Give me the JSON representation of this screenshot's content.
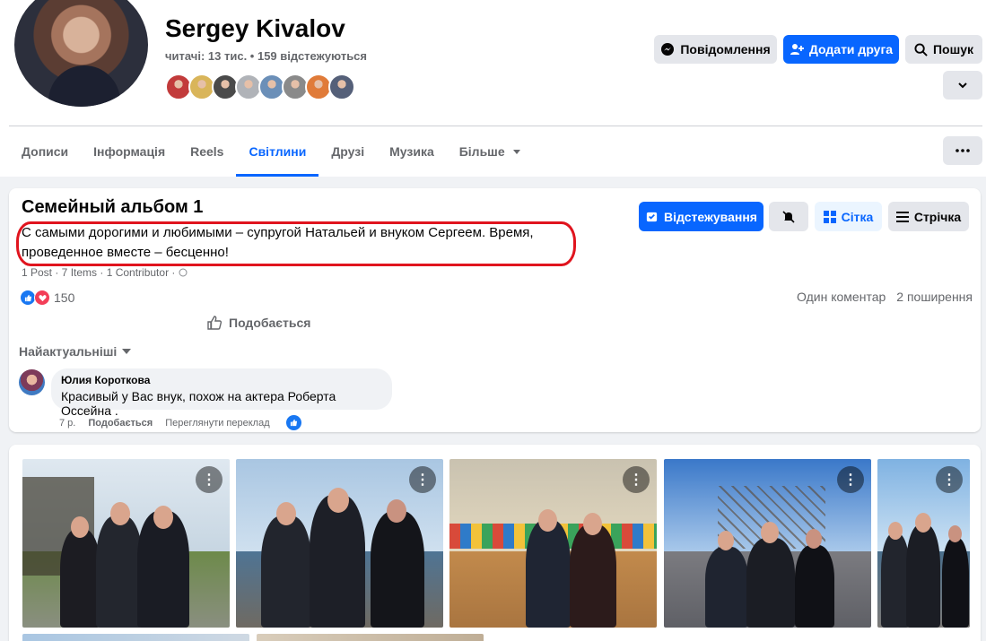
{
  "profile": {
    "name": "Sergey Kivalov",
    "followers_text": "читачі: 13 тис. • 159 відстежуються",
    "friend_avatar_colors": [
      "#c23b3b",
      "#d9b55a",
      "#4a4a4a",
      "#b0b3b8",
      "#6b8fb8",
      "#8a8a8a",
      "#e07b39",
      "#556079"
    ]
  },
  "header_buttons": {
    "message": "Повідомлення",
    "add_friend": "Додати друга",
    "search": "Пошук"
  },
  "tabs": [
    {
      "label": "Дописи"
    },
    {
      "label": "Інформація"
    },
    {
      "label": "Reels"
    },
    {
      "label": "Світлини"
    },
    {
      "label": "Друзі"
    },
    {
      "label": "Музика"
    },
    {
      "label": "Більше"
    }
  ],
  "album": {
    "title": "Семейный альбом 1",
    "description": "С самыми дорогими и любимыми – супругой Натальей и внуком Сергеем. Время, проведенное вместе – бесценно!",
    "meta": "1 Post · 7 Items · 1 Contributor ·",
    "buttons": {
      "following": "Відстежування",
      "grid": "Сітка",
      "feed": "Стрічка"
    },
    "reaction_count": "150",
    "comments_count": "Один коментар",
    "shares_count": "2 поширення",
    "like_label": "Подобається",
    "sort_label": "Найактуальніші"
  },
  "comment": {
    "author": "Юлия Короткова",
    "text": "Красивый у Вас внук, похож на актера Роберта Оссейна .",
    "time": "7 р.",
    "like": "Подобається",
    "translate": "Переглянути переклад"
  },
  "colors": {
    "accent": "#0866ff",
    "highlight_ring": "#e0141e"
  }
}
